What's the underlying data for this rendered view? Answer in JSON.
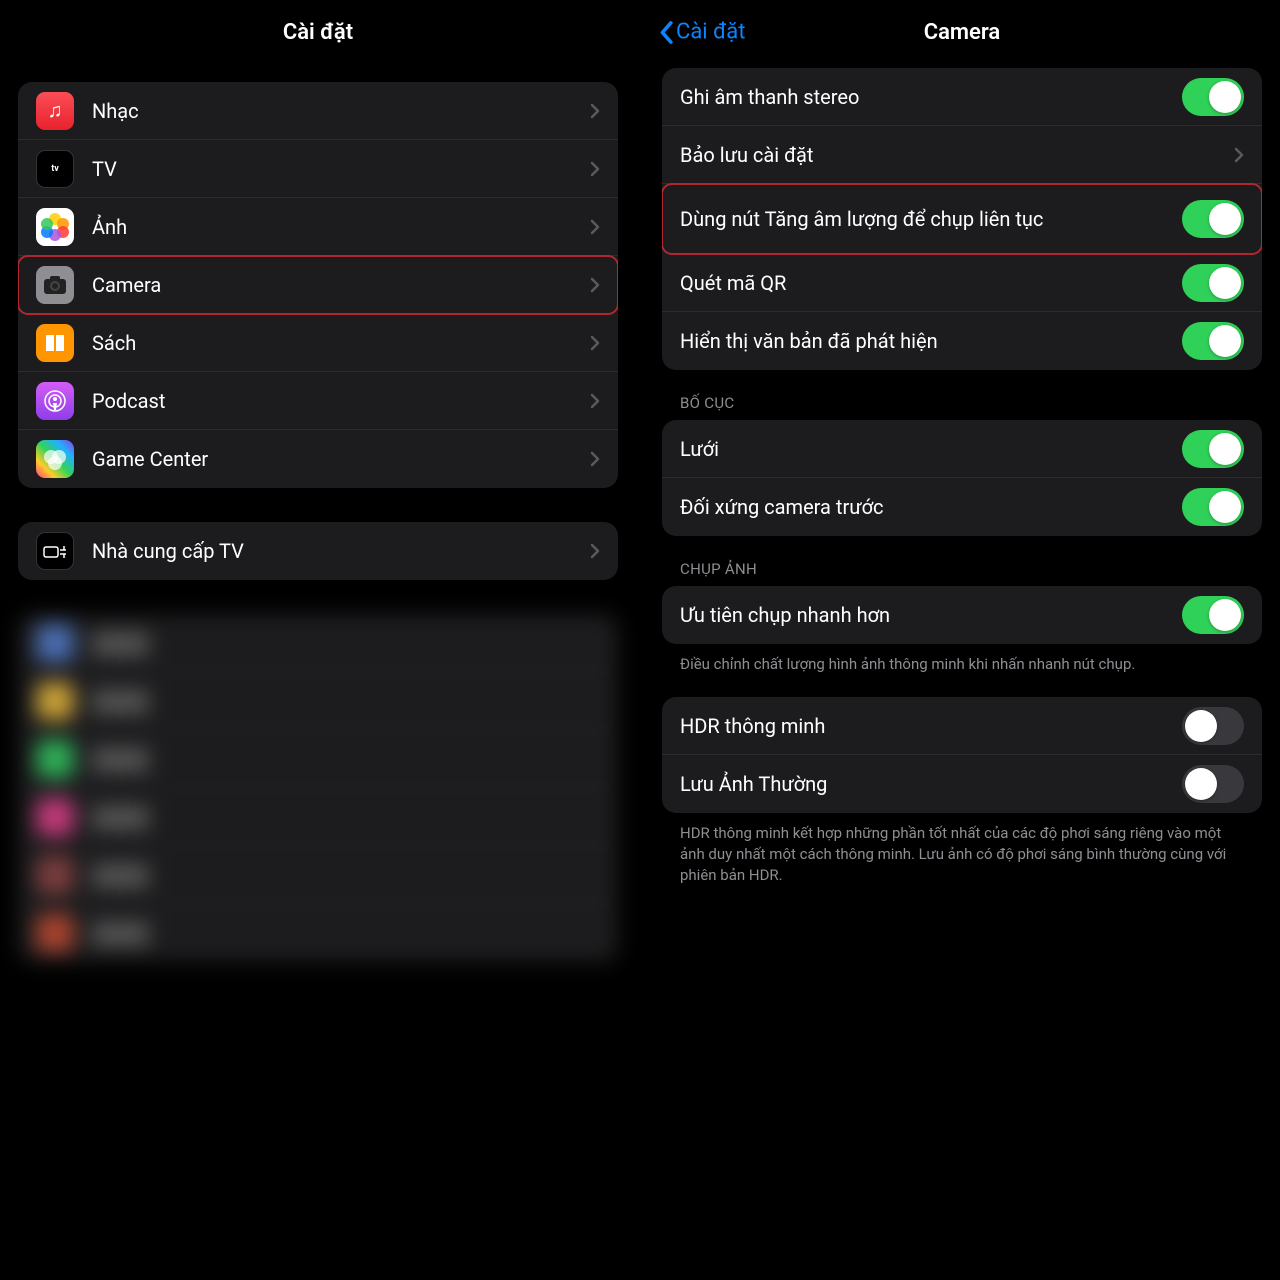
{
  "left": {
    "title": "Cài đặt",
    "group1": [
      {
        "key": "music",
        "label": "Nhạc",
        "iconClass": "ic-music",
        "iconName": "music-icon"
      },
      {
        "key": "tv",
        "label": "TV",
        "iconClass": "ic-tv",
        "iconName": "tv-icon"
      },
      {
        "key": "photos",
        "label": "Ảnh",
        "iconClass": "ic-photos",
        "iconName": "photos-icon"
      },
      {
        "key": "camera",
        "label": "Camera",
        "iconClass": "ic-camera",
        "iconName": "camera-icon",
        "highlight": true
      },
      {
        "key": "books",
        "label": "Sách",
        "iconClass": "ic-books",
        "iconName": "books-icon"
      },
      {
        "key": "podcast",
        "label": "Podcast",
        "iconClass": "ic-podcast",
        "iconName": "podcast-icon"
      },
      {
        "key": "gamecenter",
        "label": "Game Center",
        "iconClass": "ic-gamecenter",
        "iconName": "gamecenter-icon"
      }
    ],
    "group2": [
      {
        "key": "tvprovider",
        "label": "Nhà cung cấp TV",
        "iconClass": "ic-tvprovider",
        "iconName": "tvprovider-icon"
      }
    ]
  },
  "right": {
    "back": "Cài đặt",
    "title": "Camera",
    "group1": {
      "items": [
        {
          "key": "stereo",
          "label": "Ghi âm thanh stereo",
          "type": "toggle",
          "on": true
        },
        {
          "key": "preserve",
          "label": "Bảo lưu cài đặt",
          "type": "nav"
        },
        {
          "key": "burst",
          "label": "Dùng nút Tăng âm lượng để chụp liên tục",
          "type": "toggle",
          "on": true,
          "highlight": true,
          "tall": true
        },
        {
          "key": "qr",
          "label": "Quét mã QR",
          "type": "toggle",
          "on": true
        },
        {
          "key": "text",
          "label": "Hiển thị văn bản đã phát hiện",
          "type": "toggle",
          "on": true
        }
      ]
    },
    "group2": {
      "header": "BỐ CỤC",
      "items": [
        {
          "key": "grid",
          "label": "Lưới",
          "type": "toggle",
          "on": true
        },
        {
          "key": "mirror",
          "label": "Đối xứng camera trước",
          "type": "toggle",
          "on": true
        }
      ]
    },
    "group3": {
      "header": "CHỤP ẢNH",
      "items": [
        {
          "key": "faster",
          "label": "Ưu tiên chụp nhanh hơn",
          "type": "toggle",
          "on": true
        }
      ],
      "footer": "Điều chỉnh chất lượng hình ảnh thông minh khi nhấn nhanh nút chụp."
    },
    "group4": {
      "items": [
        {
          "key": "hdr",
          "label": "HDR thông minh",
          "type": "toggle",
          "on": false
        },
        {
          "key": "keepnormal",
          "label": "Lưu Ảnh Thường",
          "type": "toggle",
          "on": false
        }
      ],
      "footer": "HDR thông minh kết hợp những phần tốt nhất của các độ phơi sáng riêng vào một ảnh duy nhất một cách thông minh. Lưu ảnh có độ phơi sáng bình thường cùng với phiên bản HDR."
    }
  }
}
